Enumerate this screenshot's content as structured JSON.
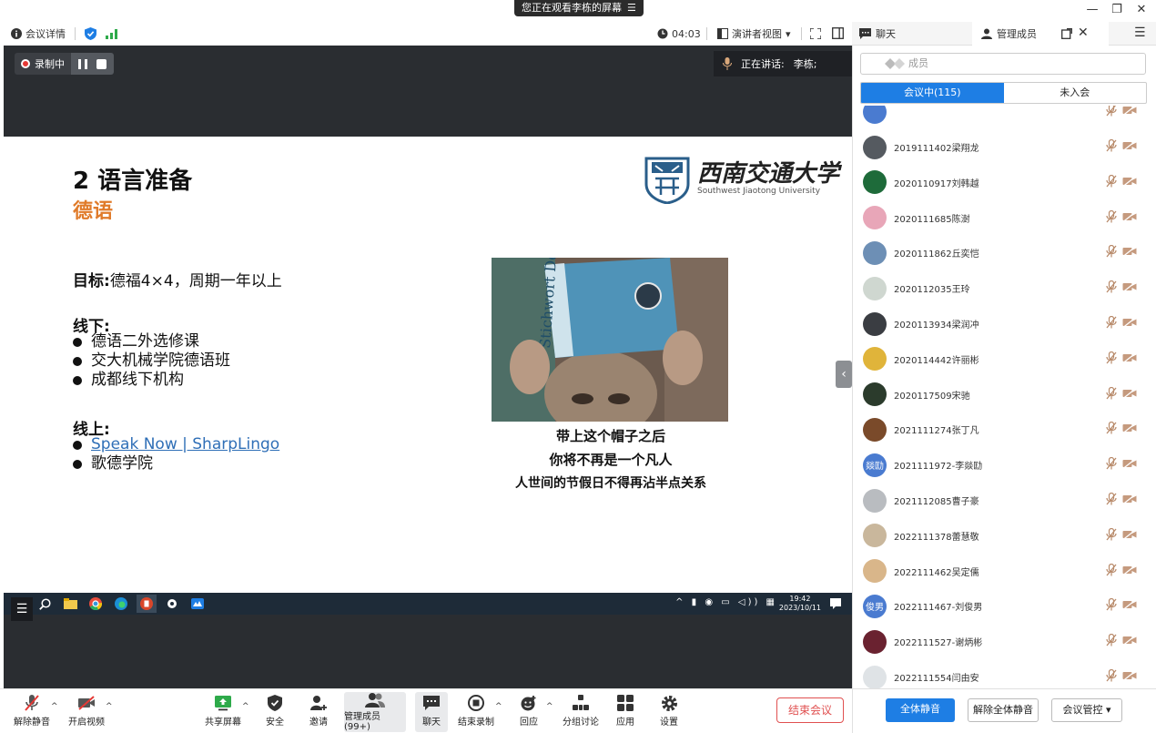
{
  "window": {
    "share_banner": "您正在观看李栋的屏幕",
    "share_banner_icon": "menu-lines-icon"
  },
  "toolbar": {
    "meeting_details": "会议详情",
    "timer": "04:03",
    "view_mode": "演讲者视图"
  },
  "panel_tabs": {
    "chat": "聊天",
    "members": "管理成员"
  },
  "recording": {
    "label": "录制中"
  },
  "speaking": {
    "label": "正在讲话:",
    "name": "李栋;"
  },
  "slide": {
    "title": "2 语言准备",
    "subtitle": "德语",
    "goal_label": "目标:",
    "goal_text": "德福4×4，周期一年以上",
    "offline_heading": "线下:",
    "offline_items": [
      "德语二外选修课",
      "交大机械学院德语班",
      "成都线下机构"
    ],
    "online_heading": "线上:",
    "online_link": "Speak Now | SharpLingo",
    "online_item2": "歌德学院",
    "logo_cn": "西南交通大学",
    "logo_en": "Southwest Jiaotong University",
    "meme_lines": [
      "带上这个帽子之后",
      "你将不再是一个凡人",
      "人世间的节假日不得再沾半点关系"
    ]
  },
  "taskbar": {
    "time": "19:42",
    "date": "2023/10/11"
  },
  "bottom_tools": {
    "unmute": "解除静音",
    "video": "开启视频",
    "share": "共享屏幕",
    "security": "安全",
    "invite": "邀请",
    "manage": "管理成员(99+)",
    "chat": "聊天",
    "end_record": "结束录制",
    "reaction": "回应",
    "breakout": "分组讨论",
    "apps": "应用",
    "settings": "设置",
    "end_meeting": "结束会议"
  },
  "panel": {
    "search_placeholder": "成员",
    "tab_in_meeting": "会议中(115)",
    "tab_not_joined": "未入会",
    "participants": [
      {
        "name": "2019111402梁翔龙",
        "color": "#555a60"
      },
      {
        "name": "2020110917刘韩越",
        "color": "#1e6b3a"
      },
      {
        "name": "2020111685陈澍",
        "color": "#e8a6b8"
      },
      {
        "name": "2020111862丘奕恺",
        "color": "#6d8fb5"
      },
      {
        "name": "2020112035王玲",
        "color": "#cfd7d0"
      },
      {
        "name": "2020113934梁润冲",
        "color": "#3a3d42"
      },
      {
        "name": "2020114442许丽彬",
        "color": "#e0b43a"
      },
      {
        "name": "2020117509宋驰",
        "color": "#2b3b2c"
      },
      {
        "name": "2021111274张丁凡",
        "color": "#7a4a2a"
      },
      {
        "name": "2021111972-李燚劻",
        "color": "#4a7bd0",
        "initials": "燚劻"
      },
      {
        "name": "2021112085曹子豪",
        "color": "#b9bcc0"
      },
      {
        "name": "2022111378蕾慧敬",
        "color": "#c9b79c"
      },
      {
        "name": "2022111462吴定儒",
        "color": "#d9b68a"
      },
      {
        "name": "2022111467-刘俊男",
        "color": "#4a7bd0",
        "initials": "俊男"
      },
      {
        "name": "2022111527-谢炳彬",
        "color": "#6a2230"
      },
      {
        "name": "2022111554闫由安",
        "color": "#dfe3e6"
      }
    ],
    "mute_all": "全体静音",
    "unmute_all": "解除全体静音",
    "controls": "会议管控"
  },
  "colors": {
    "accent": "#1e7ee4",
    "end": "#e05050",
    "subtitle": "#e07b2a"
  }
}
